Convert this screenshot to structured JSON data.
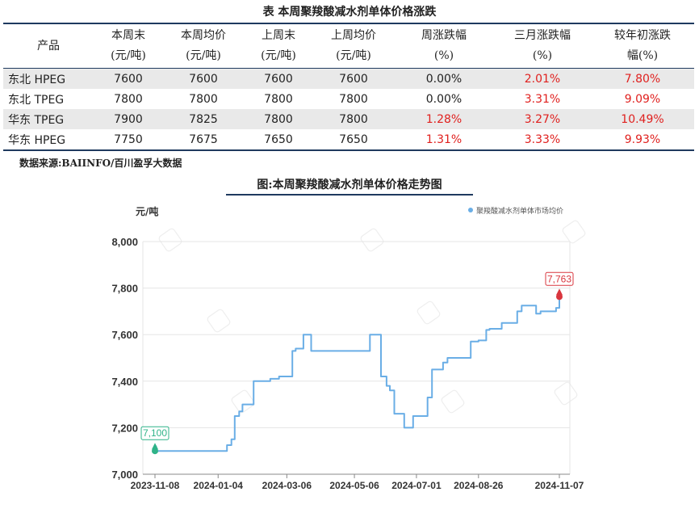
{
  "table": {
    "title": "表  本周聚羧酸减水剂单体价格涨跌",
    "headers": [
      {
        "line1": "产品",
        "line2": ""
      },
      {
        "line1": "本周末",
        "line2": "(元/吨)"
      },
      {
        "line1": "本周均价",
        "line2": "(元/吨)"
      },
      {
        "line1": "上周末",
        "line2": "(元/吨)"
      },
      {
        "line1": "上周均价",
        "line2": "(元/吨)"
      },
      {
        "line1": "周涨跌幅",
        "line2": "(%)"
      },
      {
        "line1": "三月涨跌幅",
        "line2": "(%)"
      },
      {
        "line1": "较年初涨跌",
        "line2": "幅(%)"
      }
    ],
    "rows": [
      [
        "东北 HPEG",
        "7600",
        "7600",
        "7600",
        "7600",
        "0.00%",
        "2.01%",
        "7.80%"
      ],
      [
        "东北 TPEG",
        "7800",
        "7800",
        "7800",
        "7800",
        "0.00%",
        "3.31%",
        "9.09%"
      ],
      [
        "华东 TPEG",
        "7900",
        "7825",
        "7800",
        "7800",
        "1.28%",
        "3.27%",
        "10.49%"
      ],
      [
        "华东 HPEG",
        "7750",
        "7675",
        "7650",
        "7650",
        "1.31%",
        "3.33%",
        "9.93%"
      ]
    ],
    "source": "数据来源:BAIINFO/百川盈孚大数据",
    "colors": {
      "rise": "#e0201e",
      "rule": "#1f3a5f",
      "stripe": "#e9e9e9"
    }
  },
  "chart_data": {
    "type": "line",
    "title": "图:本周聚羧酸减水剂单体价格走势图",
    "ylabel": "元/吨",
    "xlabel": "",
    "ylim": [
      7000,
      8000
    ],
    "yticks": [
      7000,
      7200,
      7400,
      7600,
      7800,
      8000
    ],
    "ytick_labels": [
      "7,000",
      "7,200",
      "7,400",
      "7,600",
      "7,800",
      "8,000"
    ],
    "xlim": [
      "2023-11-08",
      "2024-11-07"
    ],
    "xticks": [
      "2023-11-08",
      "2024-01-04",
      "2024-03-06",
      "2024-05-06",
      "2024-07-01",
      "2024-08-26",
      "2024-11-07"
    ],
    "grid": "horizontal",
    "legend": "top-right",
    "series": [
      {
        "name": "聚羧酸减水剂单体市场均价",
        "color": "#6aaee6",
        "x": [
          "2023-11-08",
          "2023-11-09",
          "2024-01-09",
          "2024-01-12",
          "2024-01-16",
          "2024-01-19",
          "2024-01-23",
          "2024-01-26",
          "2024-02-02",
          "2024-02-05",
          "2024-02-20",
          "2024-02-28",
          "2024-03-04",
          "2024-03-11",
          "2024-03-14",
          "2024-03-18",
          "2024-03-21",
          "2024-03-25",
          "2024-03-28",
          "2024-04-08",
          "2024-05-20",
          "2024-05-23",
          "2024-05-30",
          "2024-06-04",
          "2024-06-07",
          "2024-06-11",
          "2024-06-20",
          "2024-06-24",
          "2024-06-28",
          "2024-07-05",
          "2024-07-11",
          "2024-07-15",
          "2024-07-25",
          "2024-07-29",
          "2024-08-12",
          "2024-08-19",
          "2024-08-26",
          "2024-08-29",
          "2024-09-02",
          "2024-09-05",
          "2024-09-12",
          "2024-09-16",
          "2024-09-30",
          "2024-10-04",
          "2024-10-11",
          "2024-10-17",
          "2024-10-21",
          "2024-11-04",
          "2024-11-07"
        ],
        "y": [
          7120,
          7100,
          7100,
          7125,
          7150,
          7250,
          7270,
          7300,
          7300,
          7400,
          7410,
          7420,
          7420,
          7530,
          7540,
          7540,
          7600,
          7600,
          7530,
          7530,
          7600,
          7600,
          7420,
          7380,
          7360,
          7260,
          7200,
          7200,
          7250,
          7250,
          7330,
          7450,
          7480,
          7500,
          7500,
          7570,
          7575,
          7575,
          7620,
          7625,
          7625,
          7650,
          7700,
          7725,
          7725,
          7690,
          7700,
          7715,
          7763
        ]
      }
    ],
    "annotations": [
      {
        "x": "2023-11-08",
        "y": 7100,
        "label": "7,100",
        "color": "#2fb388"
      },
      {
        "x": "2024-11-07",
        "y": 7763,
        "label": "7,763",
        "color": "#d9363e"
      }
    ]
  }
}
